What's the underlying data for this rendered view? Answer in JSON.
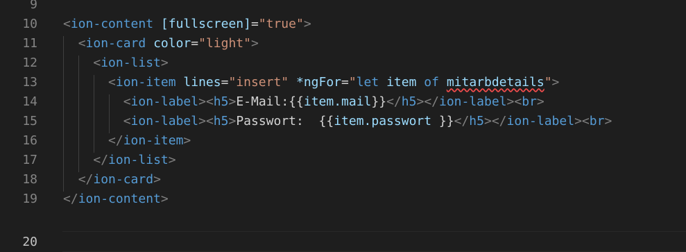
{
  "editor": {
    "line_numbers": [
      "9",
      "10",
      "11",
      "12",
      "13",
      "14",
      "15",
      "16",
      "17",
      "18",
      "19",
      "20"
    ],
    "code": {
      "l10": {
        "open": "<",
        "tag": "ion-content",
        "attr": "[fullscreen]",
        "eq": "=",
        "val": "\"true\"",
        "close": ">"
      },
      "l11": {
        "open": "<",
        "tag": "ion-card",
        "attr": "color",
        "eq": "=",
        "val": "\"light\"",
        "close": ">"
      },
      "l12": {
        "open": "<",
        "tag": "ion-list",
        "close": ">"
      },
      "l13": {
        "open": "<",
        "tag": "ion-item",
        "attr1": "lines",
        "eq1": "=",
        "val1": "\"insert\"",
        "attr2": "*ngFor",
        "eq2": "=",
        "q_open": "\"",
        "kw_let": "let",
        "ident_item": "item",
        "kw_of": "of",
        "ident_list": "mitarbdetails",
        "q_close": "\"",
        "close": ">"
      },
      "l14": {
        "open1": "<",
        "tag1": "ion-label",
        "close1": ">",
        "open2": "<",
        "tag2": "h5",
        "close2": ">",
        "text": "E-Mail:{{",
        "expr": "item.mail",
        "text_end": "}}",
        "cl_open1": "</",
        "ctag1": "h5",
        "cl_close1": ">",
        "cl_open2": "</",
        "ctag2": "ion-label",
        "cl_close2": ">",
        "br_open": "<",
        "br": "br",
        "br_close": ">"
      },
      "l15": {
        "open1": "<",
        "tag1": "ion-label",
        "close1": ">",
        "open2": "<",
        "tag2": "h5",
        "close2": ">",
        "text": "Passwort:  {{",
        "expr": "item.passwort",
        "text_end": " }}",
        "cl_open1": "</",
        "ctag1": "h5",
        "cl_close1": ">",
        "cl_open2": "</",
        "ctag2": "ion-label",
        "cl_close2": ">",
        "br_open": "<",
        "br": "br",
        "br_close": ">"
      },
      "l16": {
        "open": "</",
        "tag": "ion-item",
        "close": ">"
      },
      "l17": {
        "open": "</",
        "tag": "ion-list",
        "close": ">"
      },
      "l18": {
        "open": "</",
        "tag": "ion-card",
        "close": ">"
      },
      "l19": {
        "open": "</",
        "tag": "ion-content",
        "close": ">"
      }
    }
  },
  "colors": {
    "background": "#1e1e1e",
    "tag": "#569cd6",
    "attribute": "#9cdcfe",
    "string": "#ce9178",
    "punctuation": "#808080",
    "error_squiggle": "#f14c4c"
  }
}
